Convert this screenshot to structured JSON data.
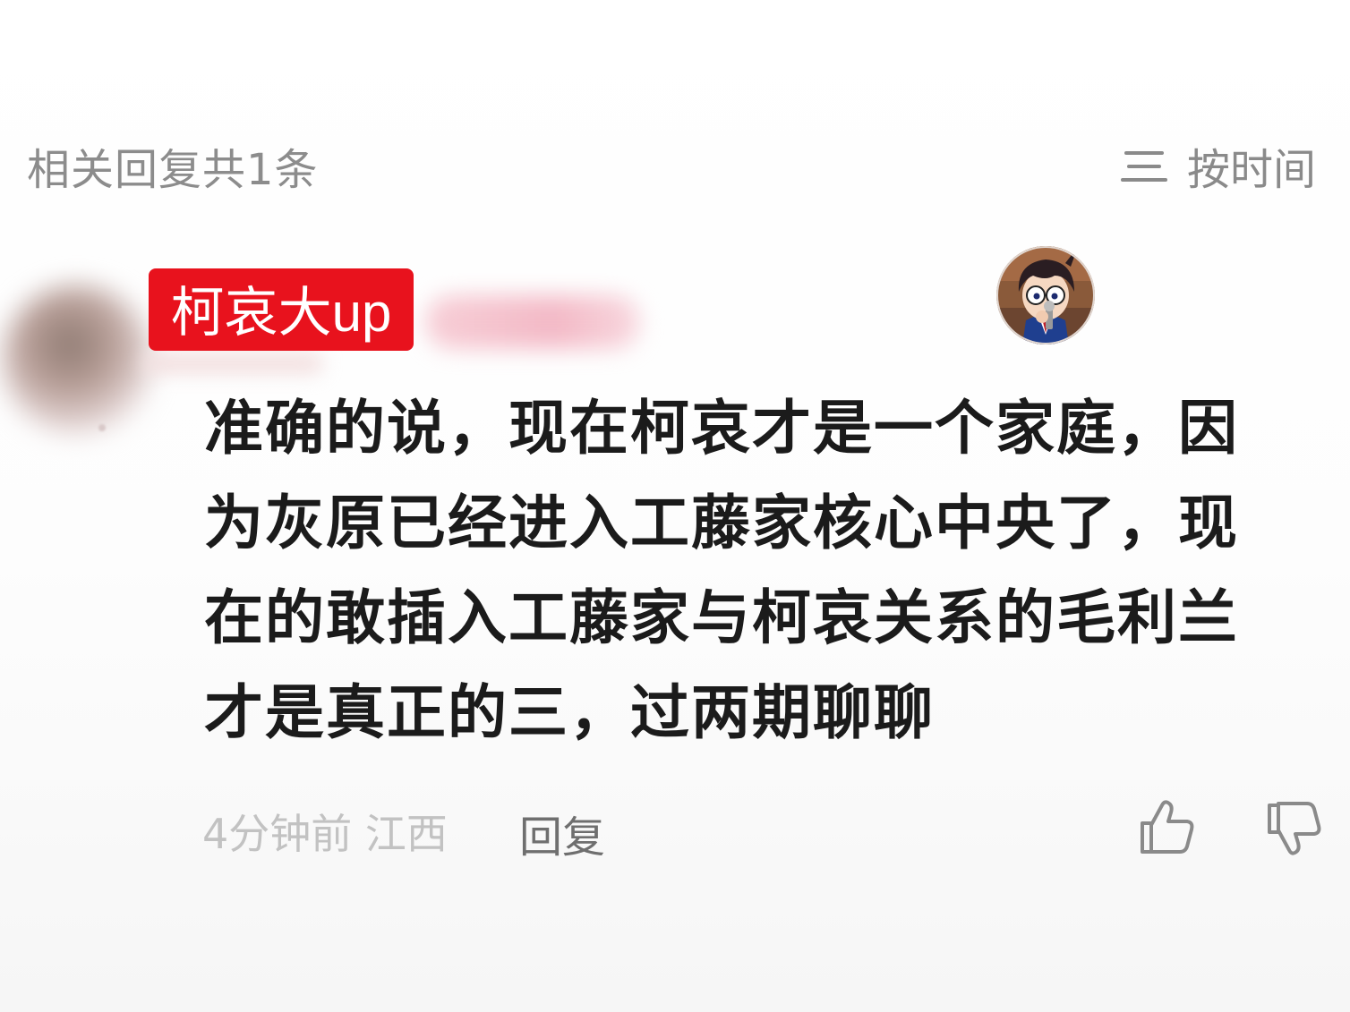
{
  "header": {
    "reply_count_label": "相关回复共1条",
    "sort_label": "按时间",
    "sort_icon": "menu-lines-icon"
  },
  "comment": {
    "user_badge": "柯哀大up",
    "text_lines": [
      "准确的说，现在柯哀才是一个家庭，因",
      "为灰原已经进入工藤家核心中央了，现",
      "在的敢插入工藤家与柯哀关系的毛利兰",
      "才是真正的三，过两期聊聊"
    ],
    "time": "4分钟前",
    "location": "江西",
    "reply_label": "回复",
    "like_icon": "thumbs-up-icon",
    "dislike_icon": "thumbs-down-icon",
    "character_avatar_icon": "conan-avatar-icon"
  },
  "colors": {
    "badge_bg": "#e8121d",
    "text_primary": "#1b1b1b",
    "text_secondary": "#8c8c8c",
    "meta_text": "#c2c2c2"
  }
}
